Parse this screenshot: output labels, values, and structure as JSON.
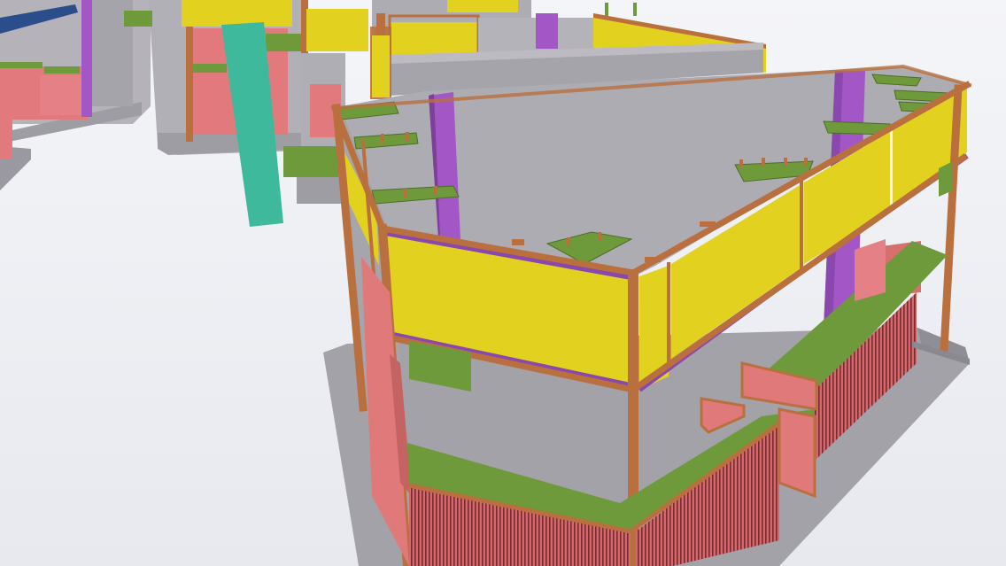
{
  "scene": {
    "colors": {
      "background_top": "#f3f4f7",
      "background_bottom": "#e6e8ee",
      "concrete": "#a9a7ad",
      "concrete_light": "#c2c0c6",
      "concrete_dark": "#8e8c93",
      "yellow_panel": "#e2d11f",
      "purple_column": "#a357c7",
      "timber_frame": "#b9703e",
      "green_slab": "#6e9a3c",
      "red_wall": "#e07a7a",
      "teal_column": "#3fb99c",
      "blue_beam": "#2c4d8c"
    }
  }
}
